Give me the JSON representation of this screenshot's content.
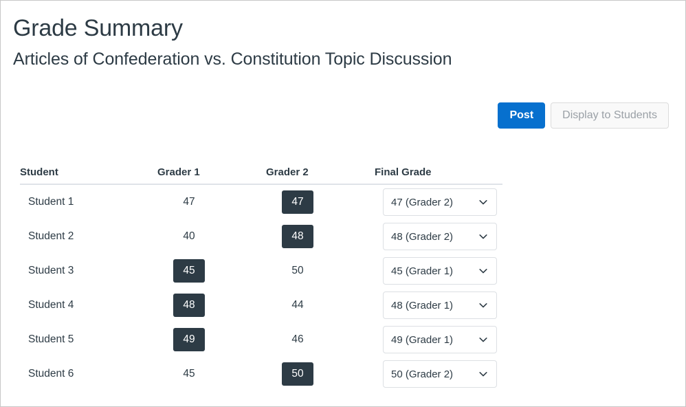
{
  "header": {
    "title": "Grade Summary",
    "subtitle": "Articles of Confederation vs. Constitution Topic Discussion"
  },
  "actions": {
    "post_label": "Post",
    "display_label": "Display to Students"
  },
  "colors": {
    "primary_blue": "#0770CE",
    "badge_dark": "#2D3B45",
    "text_dark": "#2D3B45",
    "disabled_text": "#9aa0a6",
    "border_gray": "#dcdfe3"
  },
  "table": {
    "columns": [
      "Student",
      "Grader 1",
      "Grader 2",
      "Final Grade"
    ],
    "rows": [
      {
        "student": "Student 1",
        "grader1": "47",
        "grader1_selected": false,
        "grader2": "47",
        "grader2_selected": true,
        "final_grade": "47 (Grader 2)"
      },
      {
        "student": "Student 2",
        "grader1": "40",
        "grader1_selected": false,
        "grader2": "48",
        "grader2_selected": true,
        "final_grade": "48 (Grader 2)"
      },
      {
        "student": "Student 3",
        "grader1": "45",
        "grader1_selected": true,
        "grader2": "50",
        "grader2_selected": false,
        "final_grade": "45 (Grader 1)"
      },
      {
        "student": "Student 4",
        "grader1": "48",
        "grader1_selected": true,
        "grader2": "44",
        "grader2_selected": false,
        "final_grade": "48 (Grader 1)"
      },
      {
        "student": "Student 5",
        "grader1": "49",
        "grader1_selected": true,
        "grader2": "46",
        "grader2_selected": false,
        "final_grade": "49 (Grader 1)"
      },
      {
        "student": "Student 6",
        "grader1": "45",
        "grader1_selected": false,
        "grader2": "50",
        "grader2_selected": true,
        "final_grade": "50 (Grader 2)"
      }
    ]
  },
  "icons": {
    "chevron_down": "chevron-down-icon"
  }
}
